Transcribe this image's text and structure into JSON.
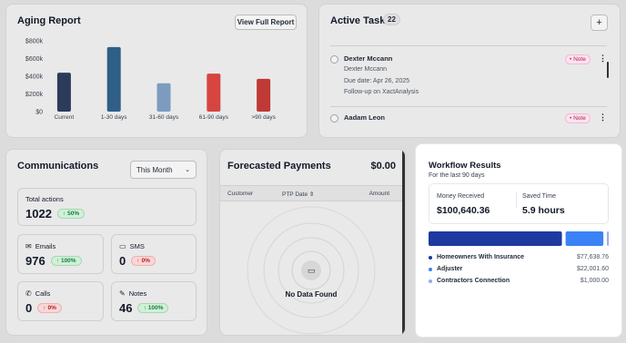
{
  "aging": {
    "title": "Aging Report",
    "button": "View Full Report",
    "chart_data": {
      "type": "bar",
      "categories": [
        "Current",
        "1-30 days",
        "31-60 days",
        "61-90 days",
        ">90 days"
      ],
      "values": [
        440000,
        730000,
        320000,
        430000,
        370000
      ],
      "colors": [
        "#2d3b5a",
        "#2f5f86",
        "#7d9bbf",
        "#d64541",
        "#bf3a36"
      ],
      "yticks": [
        "$0",
        "$200k",
        "$400k",
        "$600k",
        "$800k"
      ],
      "ylim": [
        0,
        800000
      ],
      "title": "",
      "xlabel": "",
      "ylabel": ""
    }
  },
  "tasks": {
    "title": "Active Tasks",
    "count": "22",
    "add_label": "+",
    "items": [
      {
        "name": "Dexter Mccann",
        "subname": "Dexter Mccann",
        "due": "Due date: Apr 26, 2025",
        "desc": "Follow-up on XactAnalysis",
        "badge": "Note"
      },
      {
        "name": "Aadam Leon",
        "badge": "Note"
      }
    ]
  },
  "comms": {
    "title": "Communications",
    "period": "This Month",
    "total": {
      "label": "Total actions",
      "value": "1022",
      "change": "50%"
    },
    "emails": {
      "label": "Emails",
      "value": "976",
      "change": "100%"
    },
    "sms": {
      "label": "SMS",
      "value": "0",
      "change": "0%"
    },
    "calls": {
      "label": "Calls",
      "value": "0",
      "change": "0%"
    },
    "notes": {
      "label": "Notes",
      "value": "46",
      "change": "100%"
    }
  },
  "forecast": {
    "title": "Forecasted Payments",
    "total": "$0.00",
    "col_customer": "Customer",
    "col_ptp": "PTP Date",
    "col_amount": "Amount",
    "empty": "No Data Found"
  },
  "workflow": {
    "title": "Workflow Results",
    "subtitle": "For the last 90 days",
    "money_label": "Money Received",
    "money_value": "$100,640.36",
    "time_label": "Saved Time",
    "time_value": "5.9 hours",
    "chart_data": {
      "type": "bar",
      "categories": [
        "Homeowners With Insurance",
        "Adjuster",
        "Contractors Connection"
      ],
      "values": [
        77638.76,
        22001.6,
        1000.0
      ],
      "colors": [
        "#1e3a9e",
        "#3b82f6",
        "#93a8f0"
      ]
    },
    "legend": [
      {
        "name": "Homeowners With Insurance",
        "value": "$77,638.76",
        "color": "#1e3a9e"
      },
      {
        "name": "Adjuster",
        "value": "$22,001.60",
        "color": "#3b82f6"
      },
      {
        "name": "Contractors Connection",
        "value": "$1,000.00",
        "color": "#93a8f0"
      }
    ]
  }
}
